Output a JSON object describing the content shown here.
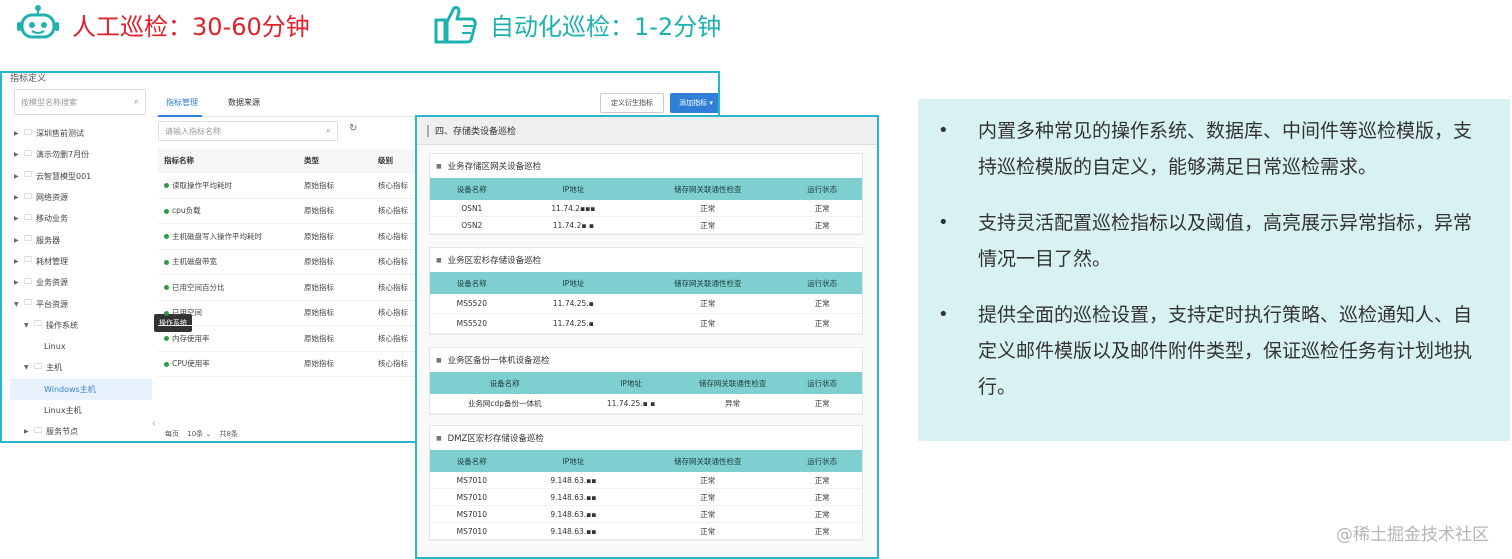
{
  "banner": {
    "manual_text": "人工巡检：30-60分钟",
    "auto_text": "自动化巡检：1-2分钟",
    "manual_icon": "robot-icon",
    "auto_icon": "thumbs-up-icon"
  },
  "left_panel": {
    "title": "指标定义",
    "tree_search_placeholder": "按模型名称搜索",
    "tree_items": [
      {
        "label": "深圳售前测试",
        "arrow": "▶",
        "indent": 0
      },
      {
        "label": "演示勿删7月份",
        "arrow": "▶",
        "indent": 0
      },
      {
        "label": "云智慧模型001",
        "arrow": "▶",
        "indent": 0
      },
      {
        "label": "网络资源",
        "arrow": "▶",
        "indent": 0
      },
      {
        "label": "移动业务",
        "arrow": "▶",
        "indent": 0
      },
      {
        "label": "服务器",
        "arrow": "▶",
        "indent": 0
      },
      {
        "label": "耗材管理",
        "arrow": "▶",
        "indent": 0
      },
      {
        "label": "业务资源",
        "arrow": "▶",
        "indent": 0
      },
      {
        "label": "平台资源",
        "arrow": "▼",
        "indent": 0
      },
      {
        "label": "操作系统",
        "arrow": "▼",
        "indent": 1
      },
      {
        "label": "Linux",
        "arrow": "",
        "indent": 2
      },
      {
        "label": "主机",
        "arrow": "▼",
        "indent": 1
      },
      {
        "label": "Windows主机",
        "arrow": "",
        "indent": 2,
        "selected": true
      },
      {
        "label": "Linux主机",
        "arrow": "",
        "indent": 2
      },
      {
        "label": "服务节点",
        "arrow": "▶",
        "indent": 1
      }
    ],
    "tooltip": "操作系统",
    "tabs": [
      "指标管理",
      "数据来源"
    ],
    "btn_define": "定义衍生指标",
    "btn_add": "添加指标 ▾",
    "metric_search_placeholder": "请输入指标名称",
    "table_headers": [
      "指标名称",
      "类型",
      "级别"
    ],
    "table_rows": [
      [
        "读取操作平均耗时",
        "原始指标",
        "核心指标"
      ],
      [
        "cpu负载",
        "原始指标",
        "核心指标"
      ],
      [
        "主机磁盘写入操作平均耗时",
        "原始指标",
        "核心指标"
      ],
      [
        "主机磁盘带宽",
        "原始指标",
        "核心指标"
      ],
      [
        "已用空间百分比",
        "原始指标",
        "核心指标"
      ],
      [
        "已用空间",
        "原始指标",
        "核心指标"
      ],
      [
        "内存使用率",
        "原始指标",
        "核心指标"
      ],
      [
        "CPU使用率",
        "原始指标",
        "核心指标"
      ]
    ],
    "pager": [
      "每页",
      "10条 ⌄",
      "共8条"
    ]
  },
  "overlay_panel": {
    "header": "四、存储类设备巡检",
    "sections": [
      {
        "title": "业务存储区网关设备巡检",
        "headers": [
          "设备名称",
          "IP地址",
          "储存网关联通性检查",
          "运行状态"
        ],
        "rows": [
          [
            "OSN1",
            "11.74.2▪▪▪",
            "正常",
            "正常"
          ],
          [
            "OSN2",
            "11.74.2▪ ▪",
            "正常",
            "正常"
          ]
        ]
      },
      {
        "title": "业务区宏杉存储设备巡检",
        "headers": [
          "设备名称",
          "IP地址",
          "储存网关联通性检查",
          "运行状态"
        ],
        "rows": [
          [
            "MS5520",
            "11.74.25.▪",
            "正常",
            "正常"
          ],
          [
            "MS5520",
            "11.74.25.▪",
            "正常",
            "正常"
          ]
        ]
      },
      {
        "title": "业务区备份一体机设备巡检",
        "headers": [
          "设备名称",
          "IP地址",
          "储存网关联通性检查",
          "运行状态"
        ],
        "rows": [
          [
            "业务网cdp备份一体机",
            "11.74.25.▪ ▪",
            "异常",
            "正常"
          ]
        ]
      },
      {
        "title": "DMZ区宏杉存储设备巡检",
        "headers": [
          "设备名称",
          "IP地址",
          "储存网关联通性检查",
          "运行状态"
        ],
        "rows": [
          [
            "MS7010",
            "9.148.63.▪▪",
            "正常",
            "正常"
          ],
          [
            "MS7010",
            "9.148.63.▪▪",
            "正常",
            "正常"
          ],
          [
            "MS7010",
            "9.148.63.▪▪",
            "正常",
            "正常"
          ],
          [
            "MS7010",
            "9.148.63.▪▪",
            "正常",
            "正常"
          ]
        ]
      }
    ]
  },
  "info": {
    "bullets": [
      "内置多种常见的操作系统、数据库、中间件等巡检模版，支持巡检模版的自定义，能够满足日常巡检需求。",
      "支持灵活配置巡检指标以及阈值，高亮展示异常指标，异常情况一目了然。",
      "提供全面的巡检设置，支持定时执行策略、巡检通知人、自定义邮件模版以及邮件附件类型，保证巡检任务有计划地执行。"
    ]
  },
  "watermark": "@稀土掘金技术社区",
  "colors": {
    "manual": "#e0202b",
    "auto": "#1fb0b0",
    "accent_border": "#2ab6c9",
    "table_head": "#7ecfcf",
    "info_bg": "#d8f1f1"
  }
}
